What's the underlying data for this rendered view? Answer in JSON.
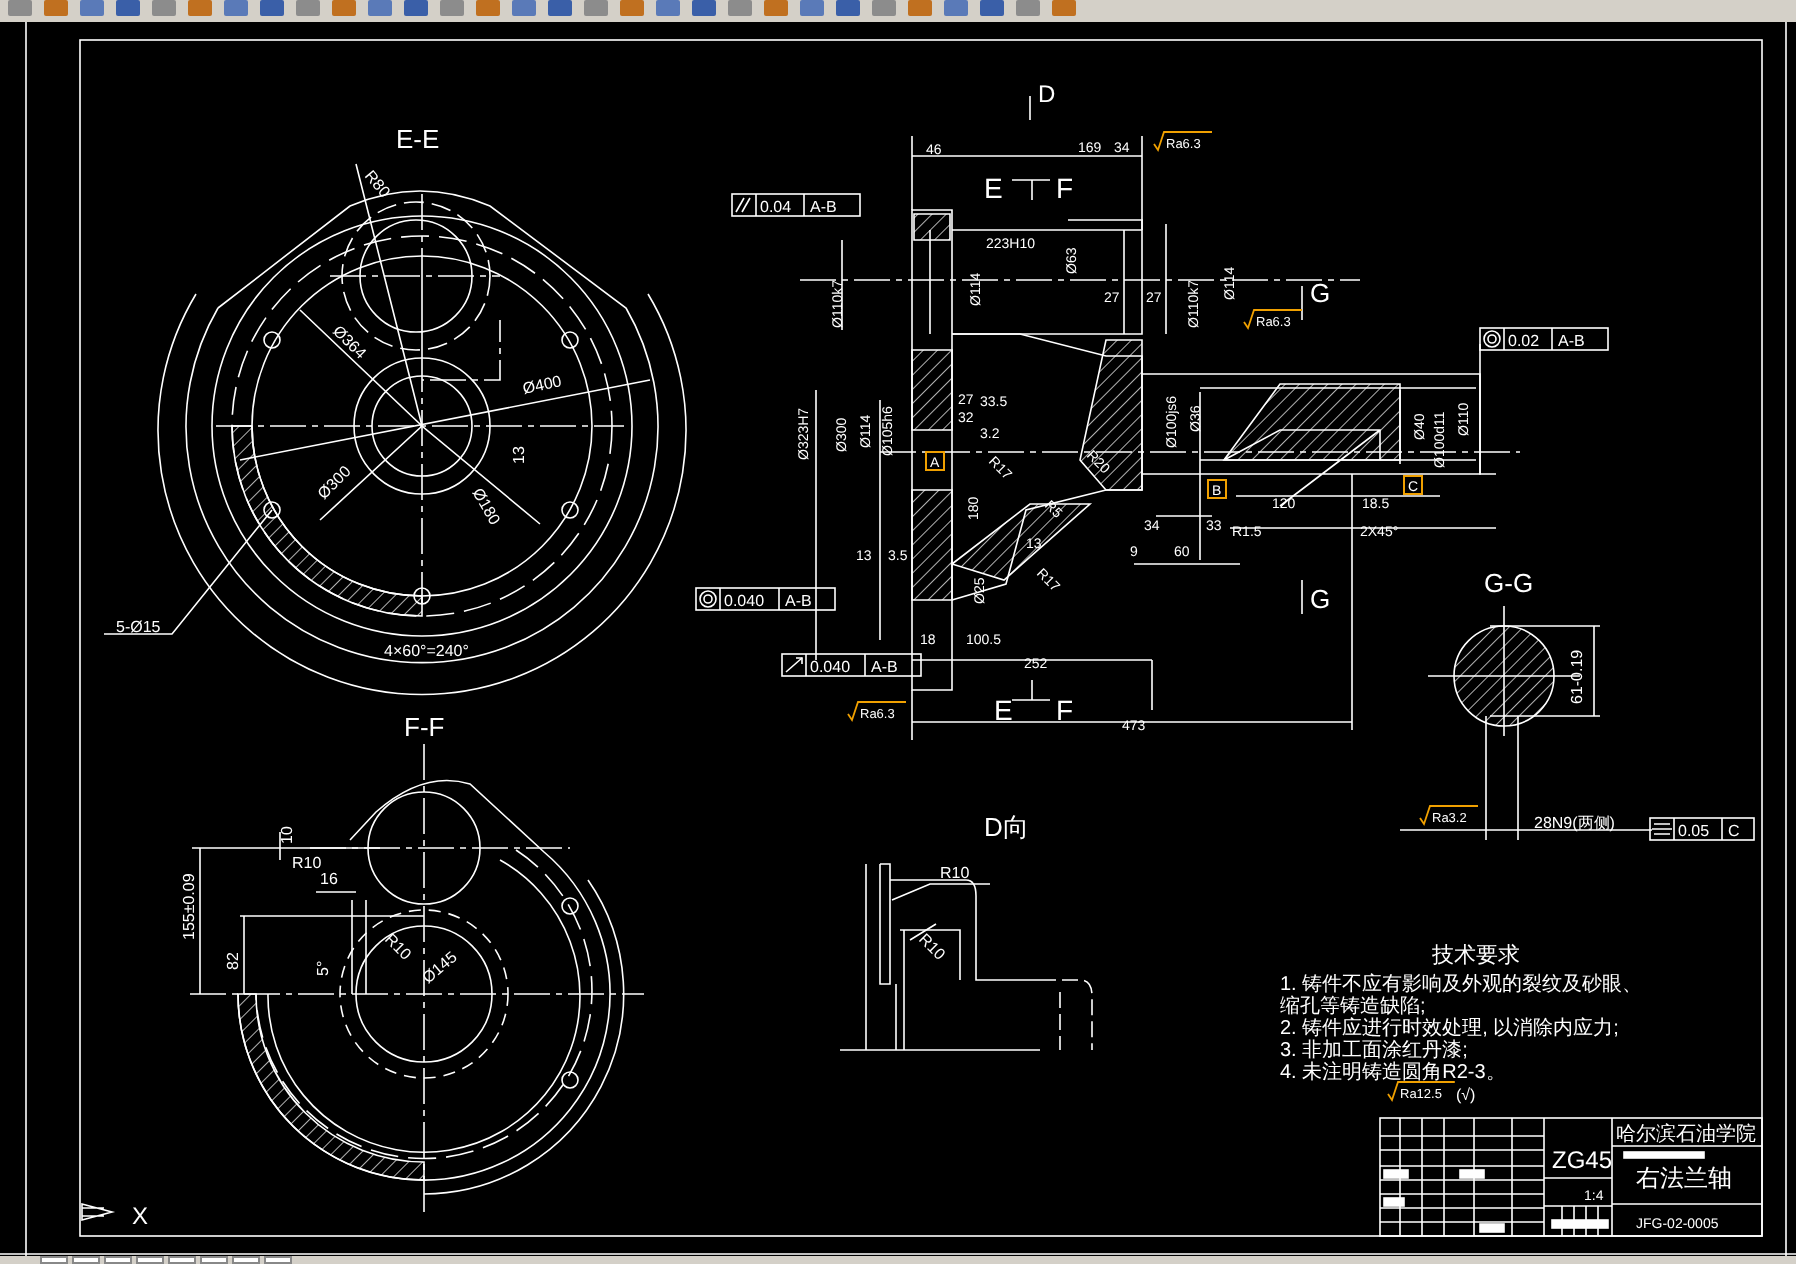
{
  "views": [
    {
      "title": "E-E",
      "dims": [
        "R80",
        "Ø364",
        "Ø400",
        "13",
        "Ø300",
        "Ø180",
        "5-Ø15",
        "4×60°=240°"
      ]
    },
    {
      "title": "F-F",
      "dims": [
        "10",
        "16",
        "R10",
        "155±0.09",
        "82",
        "R10",
        "Ø145",
        "5°"
      ]
    },
    {
      "title": "D向",
      "dims": [
        "R10",
        "R10"
      ]
    },
    {
      "title": "G-G",
      "dims": [
        "61-0.19",
        "28N9(两侧)"
      ]
    }
  ],
  "main_view": {
    "dims": [
      "D",
      "46",
      "169",
      "34",
      "E",
      "F",
      "Ø110k7",
      "223H10",
      "Ø114",
      "Ø63",
      "27",
      "27",
      "Ø110k7",
      "Ø114",
      "G",
      "Ø323H7",
      "Ø300",
      "Ø114",
      "Ø105h6",
      "27",
      "33.5",
      "32",
      "3.2",
      "R17",
      "R20",
      "180",
      "R5",
      "13",
      "13",
      "3.5",
      "Ø25",
      "R17",
      "18",
      "100.5",
      "252",
      "E",
      "F",
      "473",
      "Ø100js6",
      "Ø36",
      "120",
      "18.5",
      "34",
      "33",
      "R1.5",
      "2X45°",
      "9",
      "60",
      "Ø40",
      "Ø100d11",
      "Ø110",
      "G"
    ],
    "datums": [
      "A",
      "B",
      "C"
    ]
  },
  "tolerance_frames": [
    {
      "kind": "parallelism",
      "value": "0.04",
      "datum": "A-B"
    },
    {
      "kind": "concentricity",
      "value": "0.02",
      "datum": "A-B"
    },
    {
      "kind": "concentricity",
      "value": "0.040",
      "datum": "A-B"
    },
    {
      "kind": "runout",
      "value": "0.040",
      "datum": "A-B"
    },
    {
      "kind": "symmetry",
      "value": "0.05",
      "datum": "C"
    }
  ],
  "roughness": [
    "Ra6.3",
    "Ra6.3",
    "Ra6.3",
    "Ra3.2",
    "Ra12.5"
  ],
  "technical_requirements": {
    "title": "技术要求",
    "lines": [
      "1. 铸件不应有影响及外观的裂纹及砂眼、",
      "缩孔等铸造缺陷;",
      "2. 铸件应进行时效处理, 以消除内应力;",
      "3. 非加工面涂红丹漆;",
      "4. 未注明铸造圆角R2-3。"
    ],
    "other_surfaces": "(√)"
  },
  "title_block": {
    "material": "ZG45",
    "school": "哈尔滨石油学院",
    "part_name": "右法兰轴",
    "scale": "1:4",
    "drawing_number": "JFG-02-0005"
  },
  "ucs_label": "X"
}
